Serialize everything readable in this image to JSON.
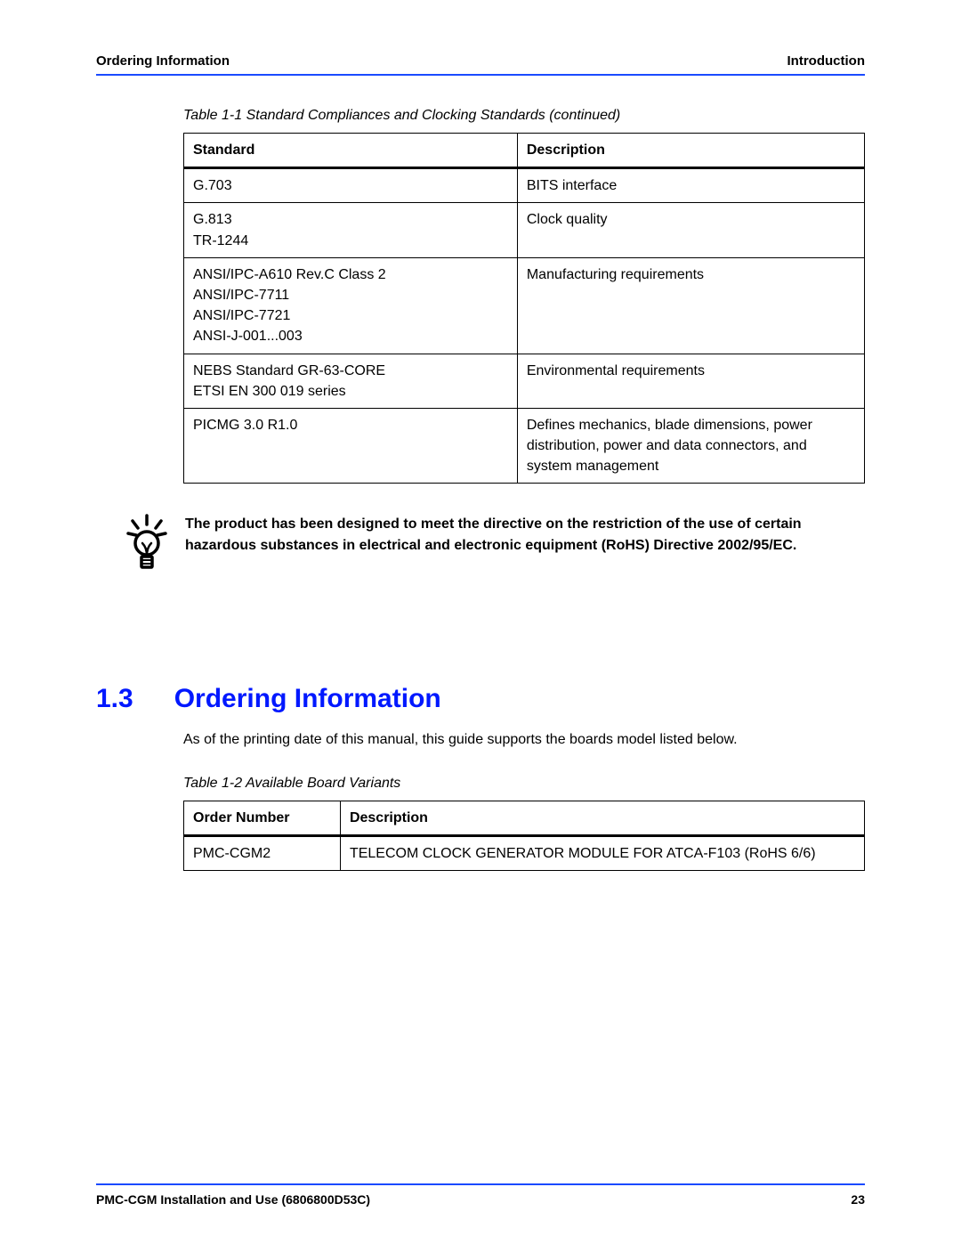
{
  "header": {
    "left": "Ordering Information",
    "right": "Introduction"
  },
  "table1": {
    "caption": "Table 1-1 Standard Compliances and Clocking Standards (continued)",
    "col1": "Standard",
    "col2": "Description",
    "rows": [
      {
        "std": "G.703",
        "desc": "BITS interface"
      },
      {
        "std": "G.813\nTR-1244",
        "desc": "Clock quality"
      },
      {
        "std": "ANSI/IPC-A610 Rev.C Class 2\nANSI/IPC-7711\nANSI/IPC-7721\nANSI-J-001...003",
        "desc": "Manufacturing requirements"
      },
      {
        "std": "NEBS Standard GR-63-CORE\nETSI EN 300 019 series",
        "desc": "Environmental requirements"
      },
      {
        "std": "PICMG 3.0 R1.0",
        "desc": "Defines mechanics, blade dimensions, power distribution, power and data connectors, and system management"
      }
    ]
  },
  "note": "The product has been designed to meet the directive on the restriction of the use of certain hazardous substances in electrical and electronic equipment (RoHS) Directive 2002/95/EC.",
  "section": {
    "num": "1.3",
    "title": "Ordering Information"
  },
  "section_body": "As of the printing date of this manual, this guide supports the boards model listed below.",
  "table2": {
    "caption": "Table 1-2 Available Board Variants",
    "col1": "Order Number",
    "col2": "Description",
    "rows": [
      {
        "ord": "PMC-CGM2",
        "desc": "TELECOM CLOCK GENERATOR MODULE FOR ATCA-F103 (RoHS 6/6)"
      }
    ]
  },
  "footer": {
    "left": "PMC-CGM Installation and Use (6806800D53C)",
    "right": "23"
  }
}
